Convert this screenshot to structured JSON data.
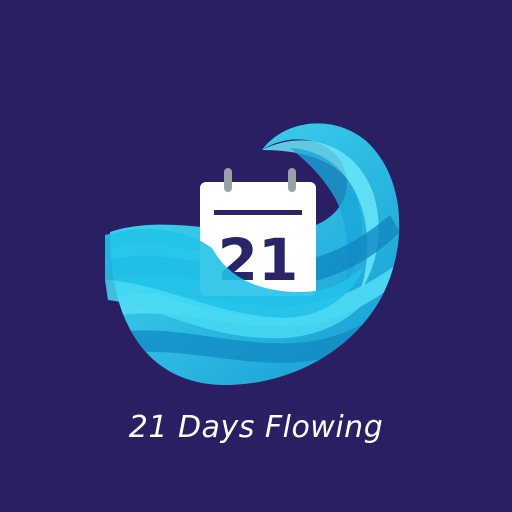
{
  "logo": {
    "calendar_day": "21",
    "icons": [
      "wave-icon",
      "calendar-icon"
    ]
  },
  "tagline": "21 Days Flowing",
  "colors": {
    "background": "#2a1f63",
    "wave_light": "#3fd6f0",
    "wave_mid": "#1fb7e0",
    "wave_dark": "#138fc4",
    "calendar_page": "#ffffff",
    "calendar_ink": "#2a2566"
  }
}
